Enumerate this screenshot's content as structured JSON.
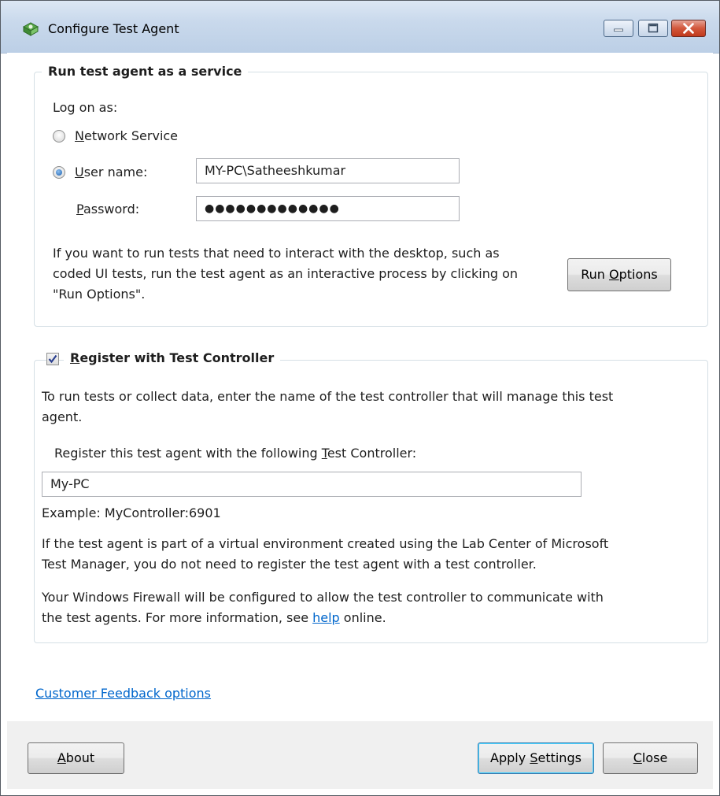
{
  "window": {
    "title": "Configure Test Agent"
  },
  "service_group": {
    "legend": "Run test agent as a service",
    "log_on_as_label": "Log on as:",
    "network_service_pre": "",
    "network_service_mn": "N",
    "network_service_post": "etwork Service",
    "user_name_pre": "",
    "user_name_mn": "U",
    "user_name_post": "ser name:",
    "user_name_value": "MY-PC\\Satheeshkumar",
    "password_pre": "",
    "password_mn": "P",
    "password_post": "assword:",
    "password_value": "●●●●●●●●●●●●●",
    "info_line1": "If you want to run tests that need to interact with the desktop, such as",
    "info_line2": "coded UI tests, run the test agent as an interactive process by clicking on",
    "info_line3": "\"Run Options\".",
    "run_options_pre": "Run ",
    "run_options_mn": "O",
    "run_options_post": "ptions",
    "selected_option": "User name"
  },
  "controller_group": {
    "legend_pre": "",
    "legend_mn": "R",
    "legend_post": "egister with Test Controller",
    "checked": true,
    "desc_line1": "To run tests or collect data, enter the name of the test controller that will manage this test",
    "desc_line2": "agent.",
    "register_label_pre": "Register this test agent with the following ",
    "register_label_mn": "T",
    "register_label_post": "est Controller:",
    "controller_value": "My-PC",
    "example": "Example: MyController:6901",
    "lab_line1": "If the test agent is part of a virtual environment created using the Lab Center of Microsoft",
    "lab_line2": "Test Manager, you do not need to register the test agent with a test controller.",
    "firewall_line1": "Your Windows Firewall will be configured to allow the test controller to communicate with",
    "firewall_line2_pre": "the test agents. For more information, see ",
    "help_link": "help",
    "firewall_line2_post": " online."
  },
  "customer_feedback_link": "Customer Feedback options",
  "footer": {
    "about_mn": "A",
    "about_post": "bout",
    "apply_pre": "Apply ",
    "apply_mn": "S",
    "apply_post": "ettings",
    "close_mn": "C",
    "close_post": "lose"
  },
  "colors": {
    "link": "#0066cc",
    "accent": "#3c7fb1"
  }
}
